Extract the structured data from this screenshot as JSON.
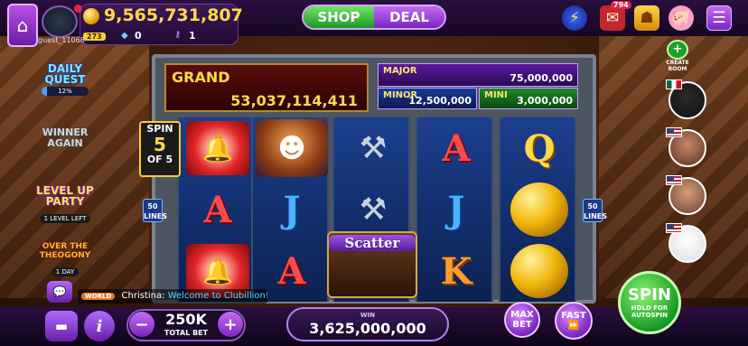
{
  "header": {
    "username": "guest_11068",
    "level": "273",
    "coins": "9,565,731,807",
    "gems": "0",
    "keys": "1",
    "shop_label": "SHOP",
    "deal_label": "DEAL",
    "book_count": "794"
  },
  "left_features": {
    "daily_quest": {
      "title_line1": "DAILY",
      "title_line2": "QUEST",
      "progress_percent": 12,
      "progress_text": "12%"
    },
    "winner_again": {
      "title_line1": "WINNER",
      "title_line2": "AGAIN"
    },
    "level_up": {
      "title_line1": "LEVEL UP",
      "title_line2": "PARTY",
      "sub": "1 LEVEL LEFT"
    },
    "theogony": {
      "title_line1": "OVER THE",
      "title_line2": "THEOGONY",
      "sub": "1 DAY"
    }
  },
  "jackpots": {
    "grand": {
      "label": "GRAND",
      "value": "53,037,114,411"
    },
    "major": {
      "label": "MAJOR",
      "value": "75,000,000"
    },
    "minor": {
      "label": "MINOR",
      "value": "12,500,000"
    },
    "mini": {
      "label": "MINI",
      "value": "3,000,000"
    }
  },
  "free_spins": {
    "top": "SPIN",
    "current": "5",
    "bottom": "OF 5"
  },
  "lines": {
    "count": "50",
    "label": "LINES"
  },
  "reels": [
    [
      "bell",
      "A",
      "bell"
    ],
    [
      "miner",
      "J",
      "A"
    ],
    [
      "pickaxe",
      "pickaxe",
      "scatter"
    ],
    [
      "A",
      "J",
      "K"
    ],
    [
      "Q",
      "gold",
      "gold"
    ]
  ],
  "scatter_label": "Scatter",
  "chat": {
    "tag": "WORLD",
    "user": "Christina:",
    "message": "Welcome to Clubillion!"
  },
  "bottom": {
    "bet_value": "250K",
    "bet_label": "TOTAL BET",
    "win_label": "WIN",
    "win_value": "3,625,000,000",
    "max_bet_line1": "MAX",
    "max_bet_line2": "BET",
    "fast_label": "FAST",
    "spin_label": "SPIN",
    "spin_sub_line1": "HOLD FOR",
    "spin_sub_line2": "AUTOSPIN"
  },
  "right_side": {
    "create_room_line1": "CREATE",
    "create_room_line2": "ROOM"
  },
  "icons": {
    "bolt": "⚡",
    "book": "✉",
    "bag": "☗",
    "piggy": "🐖",
    "menu": "☰",
    "home": "⌂",
    "chat": "💬",
    "stack": "▬",
    "info": "i",
    "minus": "−",
    "plus": "+",
    "fast": "⏩",
    "gem": "◆",
    "key": "⚷",
    "pickaxe": "⚒",
    "miner": "☻",
    "bell": "🔔"
  }
}
